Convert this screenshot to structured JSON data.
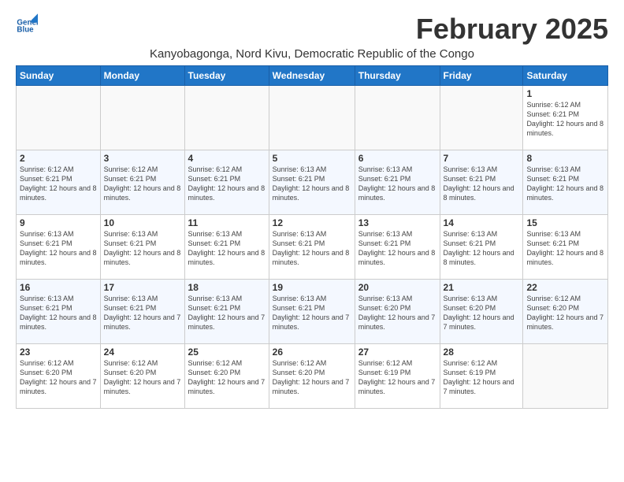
{
  "header": {
    "logo_general": "General",
    "logo_blue": "Blue",
    "month_title": "February 2025",
    "location": "Kanyobagonga, Nord Kivu, Democratic Republic of the Congo"
  },
  "days_of_week": [
    "Sunday",
    "Monday",
    "Tuesday",
    "Wednesday",
    "Thursday",
    "Friday",
    "Saturday"
  ],
  "weeks": [
    [
      {
        "day": "",
        "info": ""
      },
      {
        "day": "",
        "info": ""
      },
      {
        "day": "",
        "info": ""
      },
      {
        "day": "",
        "info": ""
      },
      {
        "day": "",
        "info": ""
      },
      {
        "day": "",
        "info": ""
      },
      {
        "day": "1",
        "info": "Sunrise: 6:12 AM\nSunset: 6:21 PM\nDaylight: 12 hours and 8 minutes."
      }
    ],
    [
      {
        "day": "2",
        "info": "Sunrise: 6:12 AM\nSunset: 6:21 PM\nDaylight: 12 hours and 8 minutes."
      },
      {
        "day": "3",
        "info": "Sunrise: 6:12 AM\nSunset: 6:21 PM\nDaylight: 12 hours and 8 minutes."
      },
      {
        "day": "4",
        "info": "Sunrise: 6:12 AM\nSunset: 6:21 PM\nDaylight: 12 hours and 8 minutes."
      },
      {
        "day": "5",
        "info": "Sunrise: 6:13 AM\nSunset: 6:21 PM\nDaylight: 12 hours and 8 minutes."
      },
      {
        "day": "6",
        "info": "Sunrise: 6:13 AM\nSunset: 6:21 PM\nDaylight: 12 hours and 8 minutes."
      },
      {
        "day": "7",
        "info": "Sunrise: 6:13 AM\nSunset: 6:21 PM\nDaylight: 12 hours and 8 minutes."
      },
      {
        "day": "8",
        "info": "Sunrise: 6:13 AM\nSunset: 6:21 PM\nDaylight: 12 hours and 8 minutes."
      }
    ],
    [
      {
        "day": "9",
        "info": "Sunrise: 6:13 AM\nSunset: 6:21 PM\nDaylight: 12 hours and 8 minutes."
      },
      {
        "day": "10",
        "info": "Sunrise: 6:13 AM\nSunset: 6:21 PM\nDaylight: 12 hours and 8 minutes."
      },
      {
        "day": "11",
        "info": "Sunrise: 6:13 AM\nSunset: 6:21 PM\nDaylight: 12 hours and 8 minutes."
      },
      {
        "day": "12",
        "info": "Sunrise: 6:13 AM\nSunset: 6:21 PM\nDaylight: 12 hours and 8 minutes."
      },
      {
        "day": "13",
        "info": "Sunrise: 6:13 AM\nSunset: 6:21 PM\nDaylight: 12 hours and 8 minutes."
      },
      {
        "day": "14",
        "info": "Sunrise: 6:13 AM\nSunset: 6:21 PM\nDaylight: 12 hours and 8 minutes."
      },
      {
        "day": "15",
        "info": "Sunrise: 6:13 AM\nSunset: 6:21 PM\nDaylight: 12 hours and 8 minutes."
      }
    ],
    [
      {
        "day": "16",
        "info": "Sunrise: 6:13 AM\nSunset: 6:21 PM\nDaylight: 12 hours and 8 minutes."
      },
      {
        "day": "17",
        "info": "Sunrise: 6:13 AM\nSunset: 6:21 PM\nDaylight: 12 hours and 7 minutes."
      },
      {
        "day": "18",
        "info": "Sunrise: 6:13 AM\nSunset: 6:21 PM\nDaylight: 12 hours and 7 minutes."
      },
      {
        "day": "19",
        "info": "Sunrise: 6:13 AM\nSunset: 6:21 PM\nDaylight: 12 hours and 7 minutes."
      },
      {
        "day": "20",
        "info": "Sunrise: 6:13 AM\nSunset: 6:20 PM\nDaylight: 12 hours and 7 minutes."
      },
      {
        "day": "21",
        "info": "Sunrise: 6:13 AM\nSunset: 6:20 PM\nDaylight: 12 hours and 7 minutes."
      },
      {
        "day": "22",
        "info": "Sunrise: 6:12 AM\nSunset: 6:20 PM\nDaylight: 12 hours and 7 minutes."
      }
    ],
    [
      {
        "day": "23",
        "info": "Sunrise: 6:12 AM\nSunset: 6:20 PM\nDaylight: 12 hours and 7 minutes."
      },
      {
        "day": "24",
        "info": "Sunrise: 6:12 AM\nSunset: 6:20 PM\nDaylight: 12 hours and 7 minutes."
      },
      {
        "day": "25",
        "info": "Sunrise: 6:12 AM\nSunset: 6:20 PM\nDaylight: 12 hours and 7 minutes."
      },
      {
        "day": "26",
        "info": "Sunrise: 6:12 AM\nSunset: 6:20 PM\nDaylight: 12 hours and 7 minutes."
      },
      {
        "day": "27",
        "info": "Sunrise: 6:12 AM\nSunset: 6:19 PM\nDaylight: 12 hours and 7 minutes."
      },
      {
        "day": "28",
        "info": "Sunrise: 6:12 AM\nSunset: 6:19 PM\nDaylight: 12 hours and 7 minutes."
      },
      {
        "day": "",
        "info": ""
      }
    ]
  ]
}
